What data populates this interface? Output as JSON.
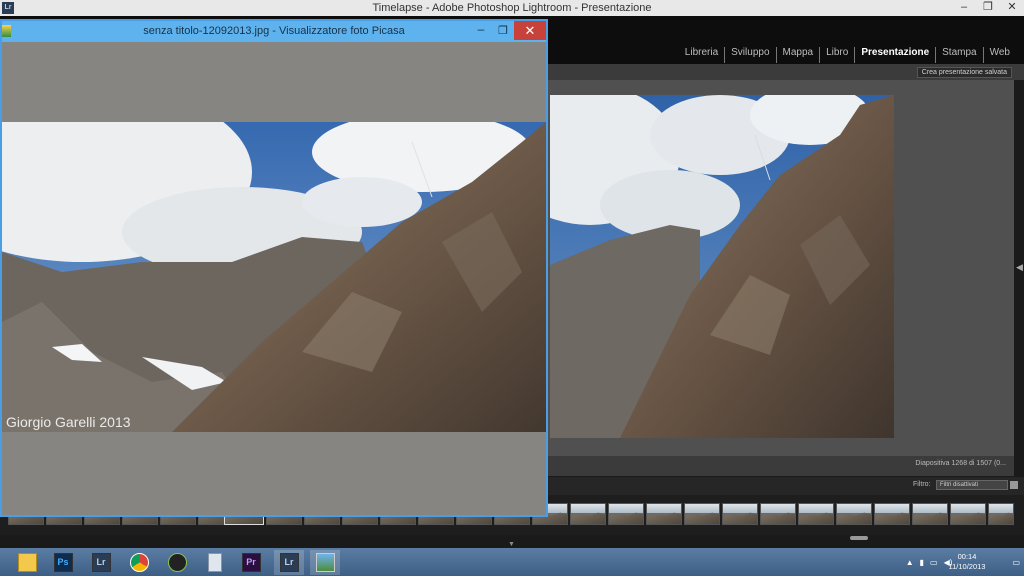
{
  "lightroom": {
    "icon": "Lr",
    "title": "Timelapse - Adobe Photoshop Lightroom - Presentazione",
    "modules": [
      "Libreria",
      "Sviluppo",
      "Mappa",
      "Libro",
      "Presentazione",
      "Stampa",
      "Web"
    ],
    "active_module": "Presentazione",
    "save_button": "Crea presentazione salvata",
    "slide_info": "Diapositiva 1268 di 1507 (0...",
    "filter_label": "Filtro:",
    "filter_value": "Filtri disattivati"
  },
  "picasa": {
    "title": "senza titolo-12092013.jpg - Visualizzatore foto Picasa",
    "watermark": "Giorgio Garelli 2013"
  },
  "taskbar": {
    "apps": [
      {
        "name": "file-explorer-icon",
        "label": ""
      },
      {
        "name": "photoshop-icon",
        "label": "Ps"
      },
      {
        "name": "lightroom-icon",
        "label": "Lr"
      },
      {
        "name": "chrome-icon",
        "label": ""
      },
      {
        "name": "speedometer-icon",
        "label": ""
      },
      {
        "name": "calculator-icon",
        "label": ""
      },
      {
        "name": "premiere-icon",
        "label": "Pr"
      },
      {
        "name": "lightroom-2-icon",
        "label": "Lr"
      },
      {
        "name": "picasa-viewer-icon",
        "label": ""
      }
    ],
    "time": "00:14",
    "date": "11/10/2013",
    "tray_icons": [
      "chevron-up-icon",
      "network-icon",
      "battery-icon",
      "volume-icon",
      "notifications-icon"
    ]
  },
  "colors": {
    "picasa_titlebar": "#5eb3ee",
    "close_red": "#c7423a",
    "lr_background": "#0d0d0d",
    "taskbar": "#4a6d96"
  }
}
